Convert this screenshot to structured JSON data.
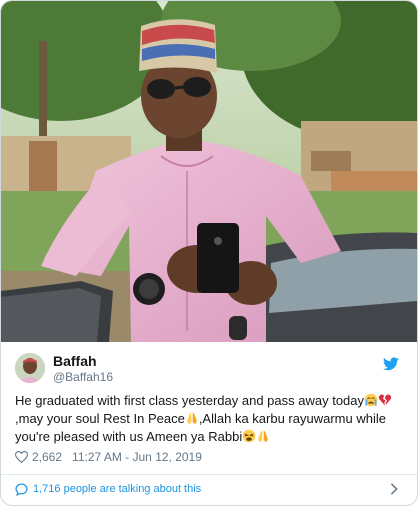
{
  "tweet": {
    "display_name": "Baffah",
    "handle": "@Baffah16",
    "text_segments": [
      "He graduated with first class yesterday and pass away today",
      ",may your soul Rest In Peace",
      ",Allah ka karbu rayuwarmu while you're pleased with us Ameen ya Rabbi"
    ],
    "emojis": [
      "crying-face",
      "broken-heart",
      "folded-hands",
      "folded-hands",
      "tired-face",
      "folded-hands"
    ],
    "likes": "2,662",
    "time": "11:27 AM - Jun 12, 2019",
    "talking": "1,716 people are talking about this"
  },
  "icons": {
    "platform": "twitter-bird-icon",
    "like": "heart-icon",
    "conversation": "speech-bubble-icon",
    "more": "chevron-right-icon"
  },
  "colors": {
    "link": "#1b95e0",
    "secondary_text": "#657786",
    "brand": "#1da1f2",
    "shirt": "#e8b4cf"
  }
}
